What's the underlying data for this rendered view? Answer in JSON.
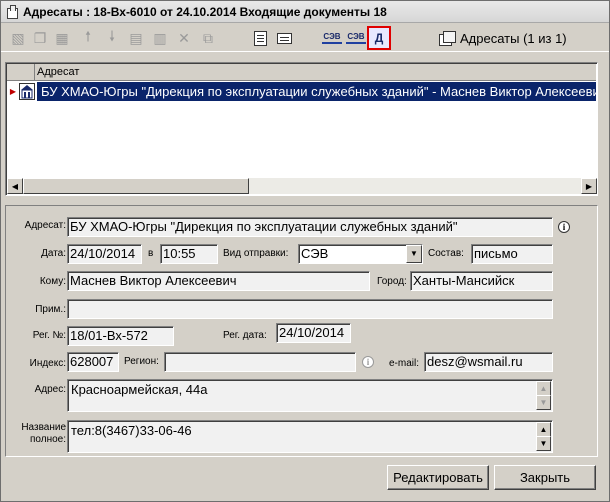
{
  "window": {
    "title": "Адресаты : 18-Вх-6010 от 24.10.2014 Входящие документы 18"
  },
  "toolbar": {
    "addressees_count": "Адресаты (1 из 1)",
    "buttons": [
      {
        "icon": "add-record-icon",
        "enabled": false
      },
      {
        "icon": "copy-record-icon",
        "enabled": false
      },
      {
        "icon": "edit-record-icon",
        "enabled": false
      },
      {
        "icon": "arrow-up-icon",
        "enabled": false
      },
      {
        "icon": "arrow-down-icon",
        "enabled": false
      },
      {
        "icon": "insert-icon",
        "enabled": false
      },
      {
        "icon": "insert-list-icon",
        "enabled": false
      },
      {
        "icon": "delete-icon",
        "enabled": false
      },
      {
        "icon": "replace-icon",
        "enabled": false
      },
      {
        "icon": "edit-document-icon",
        "enabled": true
      },
      {
        "icon": "card-icon",
        "enabled": true
      },
      {
        "icon": "sev-send-icon",
        "label": "СЭВ",
        "enabled": true
      },
      {
        "icon": "sev-receive-icon",
        "label": "СЭВ",
        "enabled": true
      },
      {
        "icon": "preview-icon",
        "label": "Д",
        "enabled": true,
        "highlighted": true
      }
    ]
  },
  "grid": {
    "column_header": "Адресат",
    "rows": [
      {
        "text": "БУ ХМАО-Югры \"Дирекция по эксплуатации служебных зданий\" - Маснев Виктор Алексеевич",
        "selected": true
      }
    ]
  },
  "form": {
    "addressee_label": "Адресат:",
    "addressee_value": "БУ ХМАО-Югры \"Дирекция по эксплуатации служебных зданий\"",
    "date_label": "Дата:",
    "date_value": "24/10/2014",
    "time_label": "в",
    "time_value": "10:55",
    "dispatch_label": "Вид отправки:",
    "dispatch_value": "СЭВ",
    "composition_label": "Состав:",
    "composition_value": "письмо",
    "to_label": "Кому:",
    "to_value": "Маснев Виктор Алексеевич",
    "city_label": "Город:",
    "city_value": "Ханты-Мансийск",
    "note_label": "Прим.:",
    "note_value": "",
    "reg_no_label": "Рег. №:",
    "reg_no_value": "18/01-Вх-572",
    "reg_date_label": "Рег. дата:",
    "reg_date_value": "24/10/2014",
    "index_label": "Индекс:",
    "index_value": "628007",
    "region_label": "Регион:",
    "region_value": "",
    "email_label": "e-mail:",
    "email_value": "desz@wsmail.ru",
    "address_label": "Адрес:",
    "address_value": "Красноармейская, 44а",
    "fullname_label_1": "Название",
    "fullname_label_2": "полное:",
    "fullname_value": "тел:8(3467)33-06-46"
  },
  "buttons": {
    "edit": "Редактировать",
    "close": "Закрыть"
  },
  "colors": {
    "selection": "#0a246a",
    "highlight_border": "#e00000",
    "window_bg": "#d4d0c8"
  }
}
